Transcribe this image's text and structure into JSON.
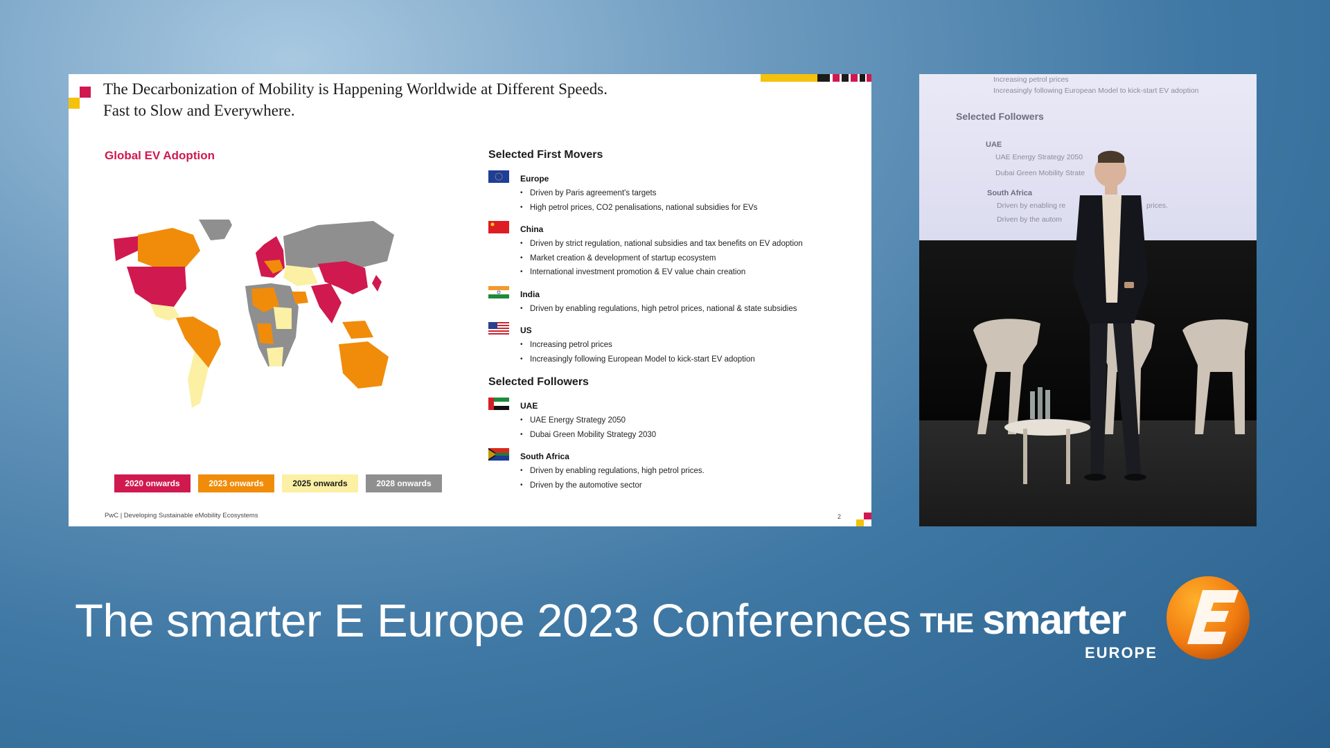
{
  "slide": {
    "title_line1": "The Decarbonization of Mobility is Happening Worldwide at Different Speeds.",
    "title_line2": "Fast to Slow and Everywhere.",
    "map_title": "Global EV Adoption",
    "legend": [
      {
        "label": "2020 onwards",
        "color": "#d0194f",
        "text_color": "#ffffff"
      },
      {
        "label": "2023 onwards",
        "color": "#f08c0a",
        "text_color": "#ffffff"
      },
      {
        "label": "2025 onwards",
        "color": "#fbf0a4",
        "text_color": "#1b1b1b"
      },
      {
        "label": "2028 onwards",
        "color": "#8f8f8f",
        "text_color": "#ffffff"
      }
    ],
    "footer": "PwC | Developing Sustainable eMobility Ecosystems",
    "page_number": "2",
    "first_movers_heading": "Selected First Movers",
    "first_movers": [
      {
        "name": "Europe",
        "flag": "eu-flag-icon",
        "bullets": [
          "Driven by Paris agreement's targets",
          "High petrol prices, CO2 penalisations, national subsidies for EVs"
        ]
      },
      {
        "name": "China",
        "flag": "china-flag-icon",
        "bullets": [
          "Driven by strict regulation, national subsidies and tax benefits on EV adoption",
          "Market creation & development of startup ecosystem",
          "International investment promotion & EV value chain creation"
        ]
      },
      {
        "name": "India",
        "flag": "india-flag-icon",
        "bullets": [
          "Driven by enabling regulations, high petrol prices, national & state subsidies"
        ]
      },
      {
        "name": "US",
        "flag": "us-flag-icon",
        "bullets": [
          "Increasing petrol prices",
          "Increasingly following European Model to kick-start EV adoption"
        ]
      }
    ],
    "followers_heading": "Selected Followers",
    "followers": [
      {
        "name": "UAE",
        "flag": "uae-flag-icon",
        "bullets": [
          "UAE Energy Strategy 2050",
          "Dubai Green Mobility Strategy 2030"
        ]
      },
      {
        "name": "South Africa",
        "flag": "south-africa-flag-icon",
        "bullets": [
          "Driven by enabling regulations, high petrol prices.",
          "Driven by the automotive sector"
        ]
      }
    ]
  },
  "video": {
    "screen_lines": [
      "Increasing petrol prices",
      "Increasingly following European Model to kick-start EV adoption"
    ],
    "screen_heading": "Selected Followers",
    "screen_uae": "UAE",
    "screen_uae_bullets": [
      "UAE Energy Strategy 2050",
      "Dubai Green Mobility Strate"
    ],
    "screen_sa": "South Africa",
    "screen_sa_bullets": [
      "Driven by enabling re",
      "Driven by the autom"
    ],
    "screen_sa_fragment": "prices."
  },
  "banner": {
    "conference_title": "The smarter E Europe 2023 Conferences",
    "logo_the": "THE",
    "logo_smarter": "smarter",
    "logo_europe": "EUROPE"
  },
  "colors": {
    "pwc_red": "#d0194f",
    "pwc_orange": "#f08c0a",
    "pwc_yellow": "#f4c20d",
    "logo_orange": "#f07a10"
  }
}
